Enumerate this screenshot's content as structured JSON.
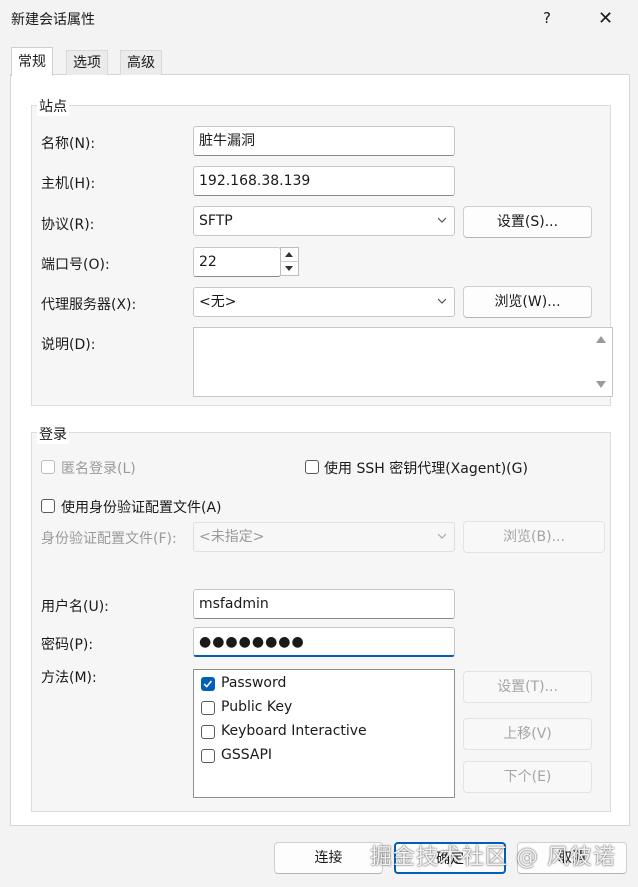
{
  "window": {
    "title": "新建会话属性",
    "help": "?",
    "close": "✕"
  },
  "tabs": [
    {
      "label": "常规",
      "active": true
    },
    {
      "label": "选项",
      "active": false
    },
    {
      "label": "高级",
      "active": false
    }
  ],
  "site": {
    "legend": "站点",
    "name_label": "名称(N):",
    "name_value": "脏牛漏洞",
    "host_label": "主机(H):",
    "host_value": "192.168.38.139",
    "protocol_label": "协议(R):",
    "protocol_value": "SFTP",
    "settings_button": "设置(S)...",
    "port_label": "端口号(O):",
    "port_value": "22",
    "proxy_label": "代理服务器(X):",
    "proxy_value": "<无>",
    "browse_button": "浏览(W)...",
    "description_label": "说明(D):"
  },
  "login": {
    "legend": "登录",
    "anonymous_label": "匿名登录(L)",
    "ssh_agent_label": "使用 SSH 密钥代理(Xagent)(G)",
    "use_auth_profile_label": "使用身份验证配置文件(A)",
    "auth_profile_label": "身份验证配置文件(F):",
    "auth_profile_value": "<未指定>",
    "auth_browse_button": "浏览(B)...",
    "username_label": "用户名(U):",
    "username_value": "msfadmin",
    "password_label": "密码(P):",
    "password_value": "●●●●●●●●",
    "method_label": "方法(M):",
    "methods": [
      {
        "label": "Password",
        "checked": true
      },
      {
        "label": "Public Key",
        "checked": false
      },
      {
        "label": "Keyboard Interactive",
        "checked": false
      },
      {
        "label": "GSSAPI",
        "checked": false
      }
    ],
    "method_settings_button": "设置(T)...",
    "move_up_button": "上移(V)",
    "move_down_button": "下个(E)"
  },
  "footer": {
    "connect": "连接",
    "ok": "确定",
    "cancel": "取消"
  },
  "watermark": "掘金技术社区 @ 风彼诺",
  "colors": {
    "accent": "#005fb8",
    "background": "#f3f3f3"
  }
}
